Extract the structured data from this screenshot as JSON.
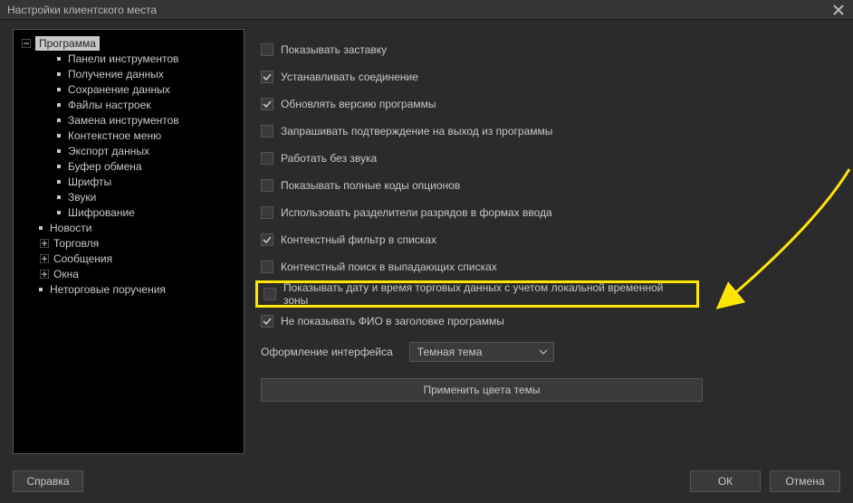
{
  "window": {
    "title": "Настройки клиентского места"
  },
  "tree": {
    "items": [
      {
        "label": "Программа",
        "depth": 0,
        "icon": "minus",
        "selected": true
      },
      {
        "label": "Панели инструментов",
        "depth": 2,
        "icon": "bullet"
      },
      {
        "label": "Получение данных",
        "depth": 2,
        "icon": "bullet"
      },
      {
        "label": "Сохранение данных",
        "depth": 2,
        "icon": "bullet"
      },
      {
        "label": "Файлы настроек",
        "depth": 2,
        "icon": "bullet"
      },
      {
        "label": "Замена инструментов",
        "depth": 2,
        "icon": "bullet"
      },
      {
        "label": "Контекстное меню",
        "depth": 2,
        "icon": "bullet"
      },
      {
        "label": "Экспорт данных",
        "depth": 2,
        "icon": "bullet"
      },
      {
        "label": "Буфер обмена",
        "depth": 2,
        "icon": "bullet"
      },
      {
        "label": "Шрифты",
        "depth": 2,
        "icon": "bullet"
      },
      {
        "label": "Звуки",
        "depth": 2,
        "icon": "bullet"
      },
      {
        "label": "Шифрование",
        "depth": 2,
        "icon": "bullet"
      },
      {
        "label": "Новости",
        "depth": 1,
        "icon": "bullet"
      },
      {
        "label": "Торговля",
        "depth": 1,
        "icon": "plus"
      },
      {
        "label": "Сообщения",
        "depth": 1,
        "icon": "plus"
      },
      {
        "label": "Окна",
        "depth": 1,
        "icon": "plus"
      },
      {
        "label": "Неторговые поручения",
        "depth": 1,
        "icon": "bullet"
      }
    ]
  },
  "options": [
    {
      "label": "Показывать заставку",
      "checked": false
    },
    {
      "label": "Устанавливать соединение",
      "checked": true
    },
    {
      "label": "Обновлять версию программы",
      "checked": true
    },
    {
      "label": "Запрашивать подтверждение на выход из программы",
      "checked": false
    },
    {
      "label": "Работать без звука",
      "checked": false
    },
    {
      "label": "Показывать полные коды опционов",
      "checked": false
    },
    {
      "label": "Использовать разделители разрядов в формах ввода",
      "checked": false
    },
    {
      "label": "Контекстный фильтр в списках",
      "checked": true
    },
    {
      "label": "Контекстный поиск в выпадающих списках",
      "checked": false
    },
    {
      "label": "Показывать дату и время торговых данных с учетом локальной временной зоны",
      "checked": false,
      "highlighted": true
    },
    {
      "label": "Не показывать ФИО в заголовке программы",
      "checked": true
    }
  ],
  "theme": {
    "label": "Оформление интерфейса",
    "value": "Темная тема"
  },
  "buttons": {
    "apply_theme": "Применить цвета темы",
    "help": "Справка",
    "ok": "ОК",
    "cancel": "Отмена"
  }
}
